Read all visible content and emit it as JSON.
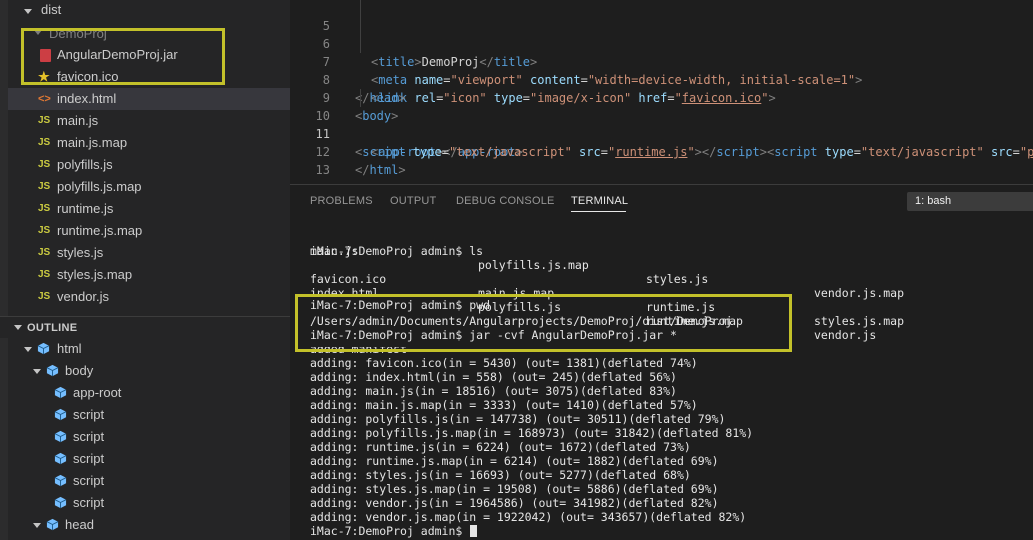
{
  "explorer": {
    "items": [
      {
        "label": "dist",
        "icon": "chevron-down-icon"
      },
      {
        "label": "DemoProj",
        "icon": "chevron-down-icon"
      },
      {
        "label": "AngularDemoProj.jar",
        "icon": "jar-file-icon"
      },
      {
        "label": "favicon.ico",
        "icon": "star-icon"
      },
      {
        "label": "index.html",
        "icon": "html-icon"
      },
      {
        "label": "main.js",
        "icon": "js-icon"
      },
      {
        "label": "main.js.map",
        "icon": "js-icon"
      },
      {
        "label": "polyfills.js",
        "icon": "js-icon"
      },
      {
        "label": "polyfills.js.map",
        "icon": "js-icon"
      },
      {
        "label": "runtime.js",
        "icon": "js-icon"
      },
      {
        "label": "runtime.js.map",
        "icon": "js-icon"
      },
      {
        "label": "styles.js",
        "icon": "js-icon"
      },
      {
        "label": "styles.js.map",
        "icon": "js-icon"
      },
      {
        "label": "vendor.js",
        "icon": "js-icon"
      }
    ],
    "icon_glyphs": {
      "js": "JS",
      "html": "<>",
      "star": "★"
    }
  },
  "outline": {
    "title": "OUTLINE",
    "items": [
      {
        "label": "html"
      },
      {
        "label": "body"
      },
      {
        "label": "app-root"
      },
      {
        "label": "script"
      },
      {
        "label": "script"
      },
      {
        "label": "script"
      },
      {
        "label": "script"
      },
      {
        "label": "script"
      },
      {
        "label": "head"
      }
    ]
  },
  "editor": {
    "line_numbers": [
      "5",
      "6",
      "7",
      "8",
      "9",
      "10",
      "11",
      "12",
      "13"
    ],
    "l5": {
      "open": "<",
      "tag": "title",
      "close": ">",
      "text": "DemoProj",
      "end_open": "</",
      "end_close": ">"
    },
    "l6": {
      "tag": "meta",
      "attr1": "name",
      "eq": "=",
      "val1": "\"viewport\"",
      "attr2": "content",
      "val2": "\"width=device-width, initial-scale=1\""
    },
    "l7": {
      "tag": "link",
      "attr1": "rel",
      "val1": "\"icon\"",
      "attr2": "type",
      "val2": "\"image/x-icon\"",
      "attr3": "href",
      "q": "\"",
      "val3": "favicon.ico"
    },
    "l8": {
      "tag": "head"
    },
    "l9": {
      "tag": "body"
    },
    "l10": {
      "tag": "app-root"
    },
    "l11": {
      "tag": "script",
      "attr1": "type",
      "val1": "\"text/javascript\"",
      "attr2": "src",
      "val2": "runtime.js",
      "tail_val": "p"
    },
    "l12": {
      "tag": "html"
    }
  },
  "panel": {
    "tabs": [
      "PROBLEMS",
      "OUTPUT",
      "DEBUG CONSOLE",
      "TERMINAL"
    ],
    "terminal_select": "1: bash",
    "colored": {
      "accent": "#c3c12a"
    },
    "ls_rows": [
      [
        "main.js",
        "polyfills.js.map",
        "styles.js",
        "vendor.js.map"
      ],
      [
        "favicon.ico",
        "main.js.map",
        "runtime.js",
        "styles.js.map"
      ],
      [
        "index.html",
        "polyfills.js",
        "runtime.js.map",
        "vendor.js"
      ],
      [
        "main.js",
        "polyfills.js.map",
        "styles.js",
        "vendor.js.map"
      ]
    ],
    "lines": {
      "ls_cmd": "iMac-7:DemoProj admin$ ls",
      "pwd_cmd": "iMac-7:DemoProj admin$ pwd",
      "pwd_out": "/Users/admin/Documents/Angularprojects/DemoProj/dist/DemoProj",
      "jar_cmd": "iMac-7:DemoProj admin$ jar -cvf AngularDemoProj.jar *",
      "manifest": "added manifest",
      "prompt": "iMac-7:DemoProj admin$ "
    },
    "adding": [
      "adding: favicon.ico(in = 5430) (out= 1381)(deflated 74%)",
      "adding: index.html(in = 558) (out= 245)(deflated 56%)",
      "adding: main.js(in = 18516) (out= 3075)(deflated 83%)",
      "adding: main.js.map(in = 3333) (out= 1410)(deflated 57%)",
      "adding: polyfills.js(in = 147738) (out= 30511)(deflated 79%)",
      "adding: polyfills.js.map(in = 168973) (out= 31842)(deflated 81%)",
      "adding: runtime.js(in = 6224) (out= 1672)(deflated 73%)",
      "adding: runtime.js.map(in = 6214) (out= 1882)(deflated 69%)",
      "adding: styles.js(in = 16693) (out= 5277)(deflated 68%)",
      "adding: styles.js.map(in = 19508) (out= 5886)(deflated 69%)",
      "adding: vendor.js(in = 1964586) (out= 341982)(deflated 82%)",
      "adding: vendor.js.map(in = 1922042) (out= 343657)(deflated 82%)"
    ]
  }
}
